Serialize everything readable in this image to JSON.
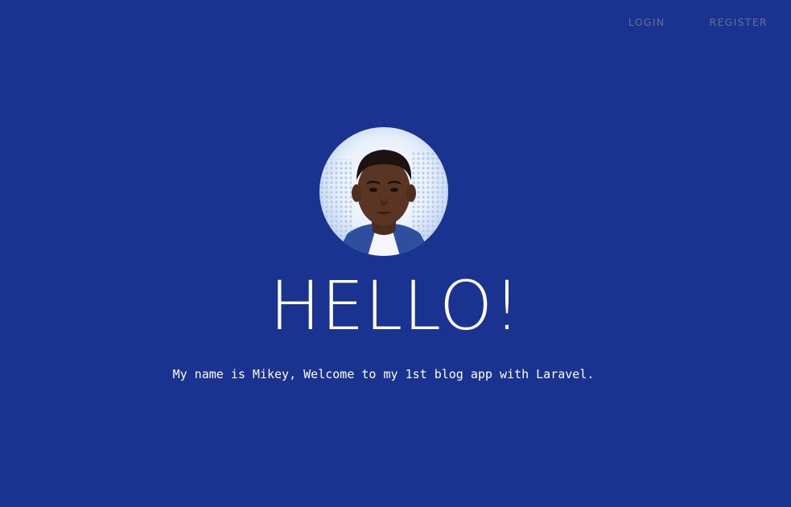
{
  "nav": {
    "login": "LOGIN",
    "register": "REGISTER"
  },
  "hero": {
    "heading": "HELLO!",
    "tagline": "My name is Mikey, Welcome to my 1st blog app with Laravel."
  },
  "colors": {
    "background": "#1a3391",
    "nav_text": "#6b6e88",
    "text": "#ffffff"
  },
  "icons": {
    "avatar": "profile-photo"
  }
}
